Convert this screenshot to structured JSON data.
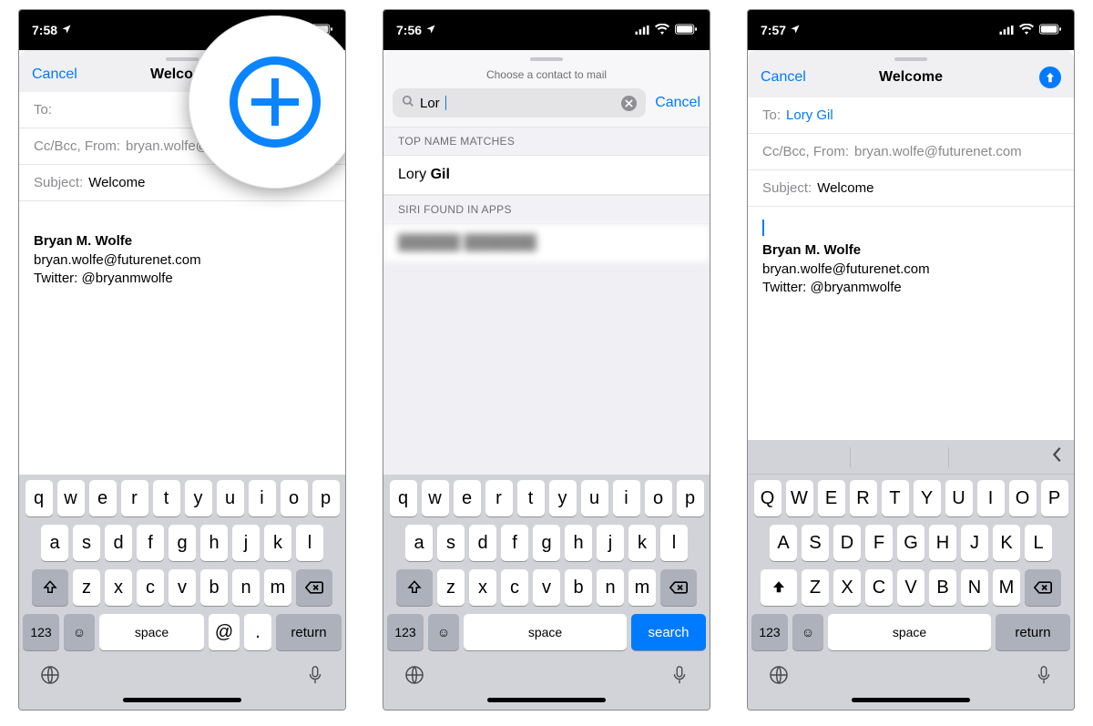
{
  "status": {
    "time_a": "7:58",
    "time_b": "7:56",
    "time_c": "7:57",
    "loc_icon": "location",
    "signal": "●●●●",
    "wifi": "wifi",
    "battery": "full"
  },
  "screen1": {
    "cancel": "Cancel",
    "title": "Welcome",
    "to_label": "To:",
    "cc_label": "Cc/Bcc, From:",
    "cc_value": "bryan.wolfe@futurenet.com",
    "subject_label": "Subject:",
    "subject_value": "Welcome",
    "sig_name": "Bryan M. Wolfe",
    "sig_email": "bryan.wolfe@futurenet.com",
    "sig_twitter": "Twitter: @bryanmwolfe"
  },
  "screen2": {
    "header": "Choose a contact to mail",
    "search_value": "Lor",
    "cancel": "Cancel",
    "section_top": "TOP NAME MATCHES",
    "match_first": "Lory",
    "match_last": "Gil",
    "section_siri": "SIRI FOUND IN APPS",
    "blurred_row": "██████ ███████"
  },
  "screen3": {
    "cancel": "Cancel",
    "title": "Welcome",
    "to_label": "To:",
    "to_value": "Lory Gil",
    "cc_label": "Cc/Bcc, From:",
    "cc_value": "bryan.wolfe@futurenet.com",
    "subject_label": "Subject:",
    "subject_value": "Welcome",
    "sig_name": "Bryan M. Wolfe",
    "sig_email": "bryan.wolfe@futurenet.com",
    "sig_twitter": "Twitter: @bryanmwolfe"
  },
  "kb_lower": {
    "row1": [
      "q",
      "w",
      "e",
      "r",
      "t",
      "y",
      "u",
      "i",
      "o",
      "p"
    ],
    "row2": [
      "a",
      "s",
      "d",
      "f",
      "g",
      "h",
      "j",
      "k",
      "l"
    ],
    "row3": [
      "z",
      "x",
      "c",
      "v",
      "b",
      "n",
      "m"
    ],
    "num": "123",
    "at": "@",
    "dot": ".",
    "space": "space",
    "return": "return",
    "search": "search"
  },
  "kb_upper": {
    "row1": [
      "Q",
      "W",
      "E",
      "R",
      "T",
      "Y",
      "U",
      "I",
      "O",
      "P"
    ],
    "row2": [
      "A",
      "S",
      "D",
      "F",
      "G",
      "H",
      "J",
      "K",
      "L"
    ],
    "row3": [
      "Z",
      "X",
      "C",
      "V",
      "B",
      "N",
      "M"
    ],
    "num": "123",
    "space": "space",
    "return": "return"
  }
}
